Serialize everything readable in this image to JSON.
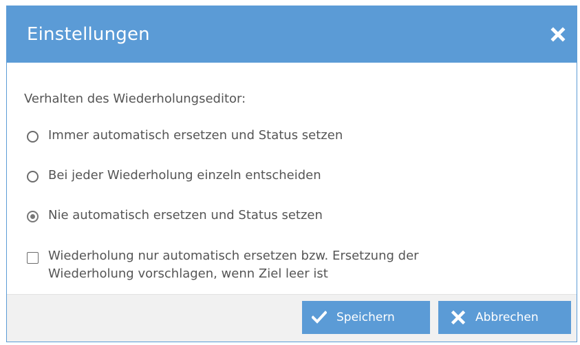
{
  "dialog": {
    "title": "Einstellungen",
    "close_icon": "close-icon"
  },
  "settings": {
    "section_label": "Verhalten des Wiederholungseditor:",
    "options": [
      {
        "label": "Immer automatisch ersetzen und Status setzen",
        "checked": false
      },
      {
        "label": "Bei jeder Wiederholung einzeln entscheiden",
        "checked": false
      },
      {
        "label": "Nie automatisch ersetzen und Status setzen",
        "checked": true
      }
    ],
    "checkbox": {
      "label": "Wiederholung nur automatisch ersetzen bzw. Ersetzung der Wiederholung vorschlagen, wenn Ziel leer ist",
      "checked": false
    }
  },
  "footer": {
    "save_label": "Speichern",
    "save_icon": "check-icon",
    "cancel_label": "Abbrechen",
    "cancel_icon": "x-icon"
  },
  "colors": {
    "accent": "#5b9bd6",
    "text": "#555555",
    "footer_bg": "#f1f1f1"
  }
}
